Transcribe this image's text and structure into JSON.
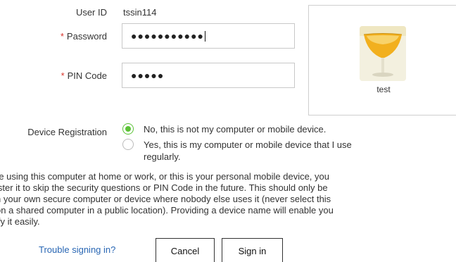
{
  "user_id": {
    "label": "User ID",
    "value": "tssin114"
  },
  "password": {
    "required_mark": "*",
    "label": "Password",
    "value": "●●●●●●●●●●●"
  },
  "pin": {
    "required_mark": "*",
    "label": "PIN Code",
    "value": "●●●●●"
  },
  "avatar": {
    "name": "test",
    "image": "cocktail-glass"
  },
  "device_registration": {
    "label": "Device Registration",
    "options": [
      {
        "text": "No, this is not my computer or mobile device.",
        "selected": true
      },
      {
        "line1": "Yes, this is my computer or mobile device that I use",
        "line2": "regularly.",
        "selected": false
      }
    ]
  },
  "info_lines": [
    "re using this computer at home or work, or this is your personal mobile device, you",
    "ister it to skip the security questions or PIN Code in the future. This should only be",
    "n your own secure computer or device where nobody else uses it (never select this",
    "on a shared computer in a public location). Providing a device name will enable you",
    "ify it easily."
  ],
  "actions": {
    "trouble_link": "Trouble signing in?",
    "cancel": "Cancel",
    "sign_in": "Sign in"
  },
  "colors": {
    "accent_green": "#5bc236",
    "required_red": "#d9342b",
    "link_blue": "#2a67b4"
  }
}
